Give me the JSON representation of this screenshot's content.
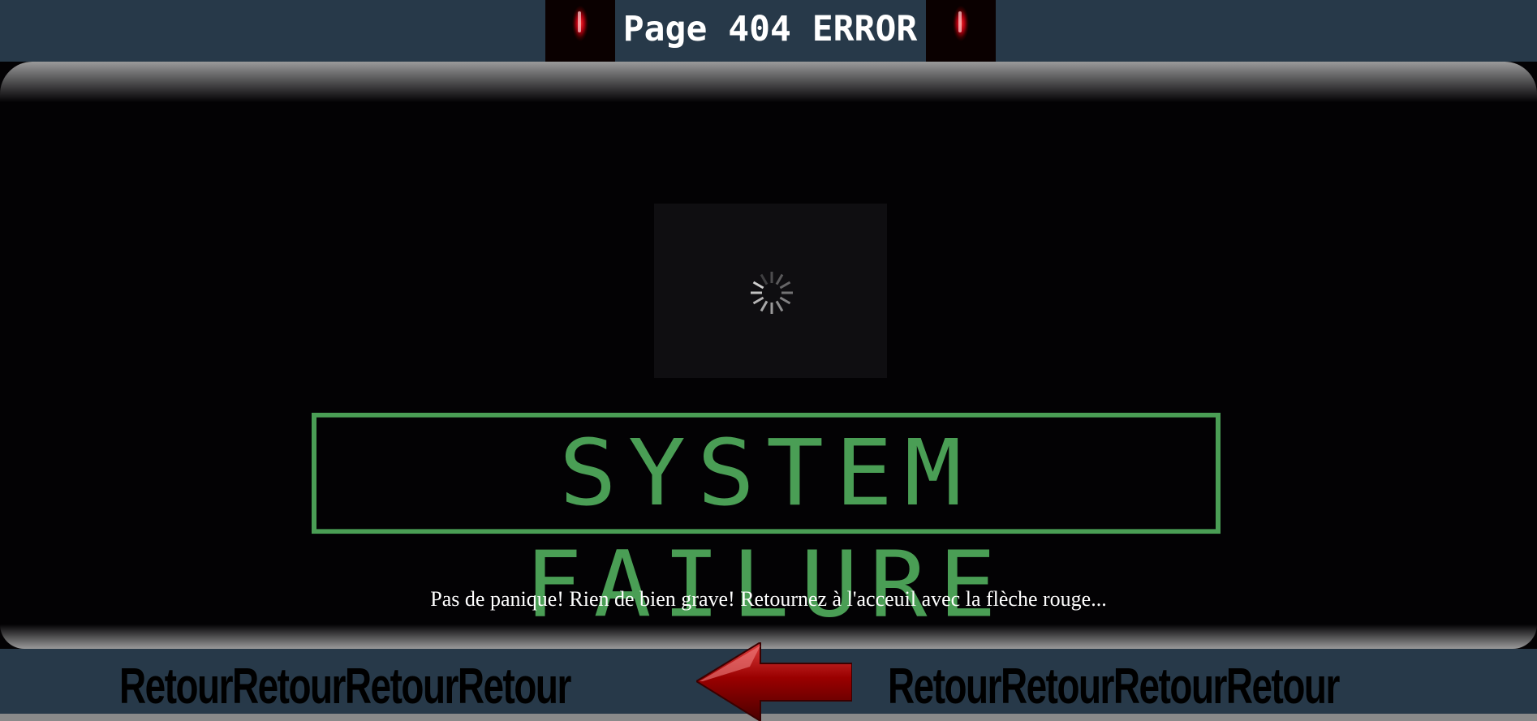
{
  "header": {
    "title": "Page 404 ERROR",
    "lamp_icon": "red-siren-icon"
  },
  "main": {
    "loader_icon": "loading-spinner-icon",
    "banner_text": "SYSTEM FAILURE",
    "caption": "Pas de panique! Rien de bien grave! Retournez à l'acceuil avec la flèche rouge..."
  },
  "footer": {
    "left_link": "RetourRetourRetourRetour",
    "right_link": "RetourRetourRetourRetour",
    "arrow_icon": "red-arrow-left-icon"
  },
  "colors": {
    "header_bg": "#273949",
    "green": "#4a9e55",
    "arrow_red": "#8b0000"
  }
}
